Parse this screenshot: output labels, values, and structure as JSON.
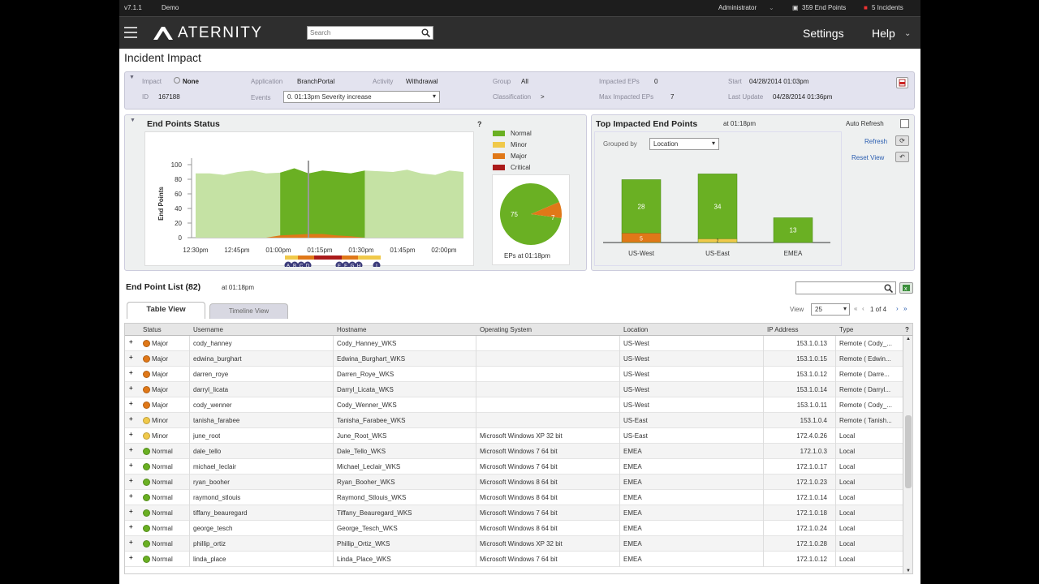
{
  "strip": {
    "version": "v7.1.1",
    "env": "Demo",
    "user": "Administrator",
    "endpoints": "359 End Points",
    "incidents": "5 Incidents"
  },
  "header": {
    "brand": "ATERNITY",
    "search_placeholder": "Search",
    "settings": "Settings",
    "help": "Help"
  },
  "page": {
    "title": "Incident Impact"
  },
  "incident": {
    "impact_label": "Impact",
    "impact_value": "None",
    "id_label": "ID",
    "id_value": "167188",
    "app_label": "Application",
    "app_value": "BranchPortal",
    "activity_label": "Activity",
    "activity_value": "Withdrawal",
    "events_label": "Events",
    "events_value": "0. 01:13pm Severity increase",
    "group_label": "Group",
    "group_value": "All",
    "class_label": "Classification",
    "class_value": ">",
    "imp_eps_label": "Impacted EPs",
    "imp_eps_value": "0",
    "max_eps_label": "Max Impacted EPs",
    "max_eps_value": "7",
    "start_label": "Start",
    "start_value": "04/28/2014 01:03pm",
    "upd_label": "Last Update",
    "upd_value": "04/28/2014 01:36pm"
  },
  "status_panel": {
    "title": "End Points Status",
    "help": "?",
    "yaxis": "End Points",
    "pie_caption": "EPs at 01:18pm",
    "legend": [
      "Normal",
      "Minor",
      "Major",
      "Critical"
    ],
    "colors": {
      "normal": "#6ab023",
      "normal_light": "#c5e2a4",
      "minor": "#f0c94a",
      "major": "#e07818",
      "critical": "#aa1a1a"
    },
    "pie_labels": [
      "75",
      "7"
    ],
    "markers": [
      "A",
      "B",
      "C",
      "D",
      "E",
      "F",
      "G",
      "H",
      "I"
    ]
  },
  "chart_data": [
    {
      "type": "area",
      "title": "End Points Status",
      "ylabel": "End Points",
      "ylim": [
        0,
        100
      ],
      "yticks": [
        "100",
        "80",
        "60",
        "40",
        "20",
        "0"
      ],
      "xticks": [
        "12:30pm",
        "12:45pm",
        "01:00pm",
        "01:15pm",
        "01:30pm",
        "01:45pm",
        "02:00pm"
      ],
      "series": [
        {
          "name": "Normal",
          "values": [
            88,
            88,
            86,
            90,
            92,
            88,
            89,
            95,
            88,
            92,
            90,
            88,
            92,
            91,
            90,
            93,
            88,
            86,
            92,
            90
          ]
        },
        {
          "name": "Major",
          "values": [
            0,
            0,
            0,
            0,
            0,
            0,
            3,
            4,
            5,
            5,
            3,
            2,
            0,
            0,
            0,
            0,
            0,
            0,
            0,
            0
          ]
        }
      ]
    },
    {
      "type": "pie",
      "title": "EPs at 01:18pm",
      "labels": [
        "Normal",
        "Major"
      ],
      "values": [
        75,
        7
      ]
    },
    {
      "type": "bar",
      "title": "Top Impacted End Points",
      "categories": [
        "US-West",
        "US-East",
        "EMEA"
      ],
      "series": [
        {
          "name": "Normal",
          "values": [
            28,
            34,
            13
          ]
        },
        {
          "name": "Minor",
          "values": [
            0,
            2,
            0
          ]
        },
        {
          "name": "Major",
          "values": [
            5,
            0,
            0
          ]
        }
      ]
    }
  ],
  "top_panel": {
    "title": "Top Impacted End Points",
    "at": "at 01:18pm",
    "grouped_by": "Grouped by",
    "grouped_value": "Location",
    "auto_refresh": "Auto Refresh",
    "refresh": "Refresh",
    "reset": "Reset View",
    "bars": [
      {
        "cat": "US-West",
        "normal": "28",
        "minor": "",
        "major": "5"
      },
      {
        "cat": "US-East",
        "normal": "34",
        "minor": "2",
        "major": ""
      },
      {
        "cat": "EMEA",
        "normal": "13",
        "minor": "",
        "major": ""
      }
    ]
  },
  "list": {
    "title": "End Point List (82)",
    "at": "at 01:18pm",
    "tab_table": "Table View",
    "tab_timeline": "Timeline View",
    "view_label": "View",
    "view_value": "25",
    "pager": "1 of 4",
    "headers": [
      "Status",
      "Username",
      "Hostname",
      "Operating System",
      "Location",
      "IP Address",
      "Type",
      "?"
    ],
    "rows": [
      [
        "Major",
        "cody_hanney",
        "Cody_Hanney_WKS",
        "",
        "US-West",
        "153.1.0.13",
        "Remote ( Cody_..."
      ],
      [
        "Major",
        "edwina_burghart",
        "Edwina_Burghart_WKS",
        "",
        "US-West",
        "153.1.0.15",
        "Remote ( Edwin..."
      ],
      [
        "Major",
        "darren_roye",
        "Darren_Roye_WKS",
        "",
        "US-West",
        "153.1.0.12",
        "Remote ( Darre..."
      ],
      [
        "Major",
        "darryl_licata",
        "Darryl_Licata_WKS",
        "",
        "US-West",
        "153.1.0.14",
        "Remote ( Darryl..."
      ],
      [
        "Major",
        "cody_wenner",
        "Cody_Wenner_WKS",
        "",
        "US-West",
        "153.1.0.11",
        "Remote ( Cody_..."
      ],
      [
        "Minor",
        "tanisha_farabee",
        "Tanisha_Farabee_WKS",
        "",
        "US-East",
        "153.1.0.4",
        "Remote ( Tanish..."
      ],
      [
        "Minor",
        "june_root",
        "June_Root_WKS",
        "Microsoft Windows XP 32 bit",
        "US-East",
        "172.4.0.26",
        "Local"
      ],
      [
        "Normal",
        "dale_tello",
        "Dale_Tello_WKS",
        "Microsoft Windows 7 64 bit",
        "EMEA",
        "172.1.0.3",
        "Local"
      ],
      [
        "Normal",
        "michael_leclair",
        "Michael_Leclair_WKS",
        "Microsoft Windows 7 64 bit",
        "EMEA",
        "172.1.0.17",
        "Local"
      ],
      [
        "Normal",
        "ryan_booher",
        "Ryan_Booher_WKS",
        "Microsoft Windows 8 64 bit",
        "EMEA",
        "172.1.0.23",
        "Local"
      ],
      [
        "Normal",
        "raymond_stlouis",
        "Raymond_Stlouis_WKS",
        "Microsoft Windows 8 64 bit",
        "EMEA",
        "172.1.0.14",
        "Local"
      ],
      [
        "Normal",
        "tiffany_beauregard",
        "Tiffany_Beauregard_WKS",
        "Microsoft Windows 7 64 bit",
        "EMEA",
        "172.1.0.18",
        "Local"
      ],
      [
        "Normal",
        "george_tesch",
        "George_Tesch_WKS",
        "Microsoft Windows 8 64 bit",
        "EMEA",
        "172.1.0.24",
        "Local"
      ],
      [
        "Normal",
        "phillip_ortiz",
        "Phillip_Ortiz_WKS",
        "Microsoft Windows XP 32 bit",
        "EMEA",
        "172.1.0.28",
        "Local"
      ],
      [
        "Normal",
        "linda_place",
        "Linda_Place_WKS",
        "Microsoft Windows 7 64 bit",
        "EMEA",
        "172.1.0.12",
        "Local"
      ]
    ]
  }
}
